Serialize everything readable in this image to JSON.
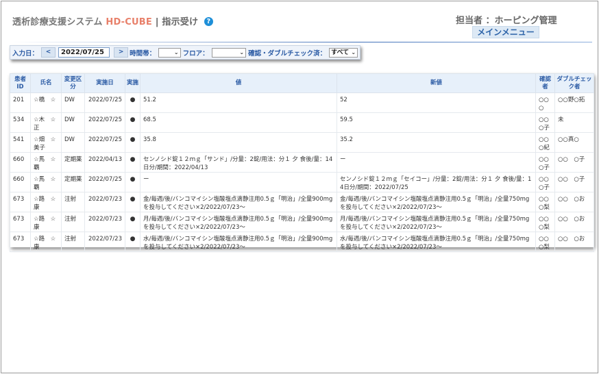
{
  "header": {
    "title_main": "透析診療支援システム",
    "title_brand": "HD-CUBE",
    "title_sep": "|",
    "title_sub": "指示受け",
    "help_icon_glyph": "?",
    "user_label": "担当者 ：ホーピング管理",
    "main_menu_label": "メインメニュー"
  },
  "filters": {
    "date_label": "入力日：",
    "prev_label": "<",
    "date_value": "2022/07/25",
    "next_label": ">",
    "time_label": "時間帯：",
    "time_value": "",
    "floor_label": "フロア：",
    "floor_value": "",
    "check_label": "確認・ダブルチェック済：",
    "check_value": "すべて"
  },
  "table": {
    "headers": {
      "patient_id": "患者ID",
      "name": "氏名",
      "change_type": "変更区分",
      "date": "実施日",
      "exec": "実施",
      "value": "値",
      "new_value": "新値",
      "confirmer": "確認者",
      "double_checker": "ダブルチェック者"
    },
    "rows": [
      {
        "id": "201",
        "name": "☆橋　☆",
        "type": "DW",
        "date": "2022/07/25",
        "exec": "●",
        "value": "51.2",
        "new_value": "52",
        "confirmer": "○○○",
        "double": "○○野○拓"
      },
      {
        "id": "534",
        "name": "☆木　☆正",
        "type": "DW",
        "date": "2022/07/25",
        "exec": "●",
        "value": "68.5",
        "new_value": "59.5",
        "confirmer": "○○○子",
        "double": "未"
      },
      {
        "id": "541",
        "name": "☆畑　☆美子",
        "type": "DW",
        "date": "2022/07/25",
        "exec": "●",
        "value": "35.8",
        "new_value": "35.2",
        "confirmer": "○○○紀",
        "double": "○○真○"
      },
      {
        "id": "660",
        "name": "☆馬　☆覇",
        "type": "定期薬",
        "date": "2022/04/13",
        "exec": "●",
        "value": "センノシド錠１２ｍｇ「サンド」/分量：2錠/用法：分１ 夕 食後/量：14日分/期間：2022/04/13",
        "new_value": "ー",
        "confirmer": "○○○子",
        "double": "○○　○子"
      },
      {
        "id": "660",
        "name": "☆馬　☆覇",
        "type": "定期薬",
        "date": "2022/07/25",
        "exec": "●",
        "value": "ー",
        "new_value": "センノシド錠１２ｍｇ「セイコー」/分量：2錠/用法：分１ 夕 食後/量：14日分/期間：2022/07/25",
        "confirmer": "○○○子",
        "double": "○○　○子"
      },
      {
        "id": "673",
        "name": "☆路　☆康",
        "type": "注射",
        "date": "2022/07/23",
        "exec": "●",
        "value": "金/毎週/後/バンコマイシン塩酸塩点滴静注用0.5ｇ「明治」/全量900mgを投与してください×2/2022/07/23〜",
        "new_value": "金/毎週/後/バンコマイシン塩酸塩点滴静注用0.5ｇ「明治」/全量750mgを投与してください×2/2022/07/23〜",
        "confirmer": "○○○梨",
        "double": "○○　○お"
      },
      {
        "id": "673",
        "name": "☆路　☆康",
        "type": "注射",
        "date": "2022/07/23",
        "exec": "●",
        "value": "月/毎週/後/バンコマイシン塩酸塩点滴静注用0.5ｇ「明治」/全量900mgを投与してください×2/2022/07/23〜",
        "new_value": "月/毎週/後/バンコマイシン塩酸塩点滴静注用0.5ｇ「明治」/全量750mgを投与してください×2/2022/07/23〜",
        "confirmer": "○○○梨",
        "double": "○○　○お"
      },
      {
        "id": "673",
        "name": "☆路　☆康",
        "type": "注射",
        "date": "2022/07/23",
        "exec": "●",
        "value": "水/毎週/後/バンコマイシン塩酸塩点滴静注用0.5ｇ「明治」/全量900mgを投与してください×2/2022/07/23〜",
        "new_value": "水/毎週/後/バンコマイシン塩酸塩点滴静注用0.5ｇ「明治」/全量750mgを投与してください×2/2022/07/23〜",
        "confirmer": "○○○梨",
        "double": "○○　○お"
      }
    ]
  },
  "colors": {
    "brand": "#e8806a",
    "accent": "#2a5aa4",
    "header_bg": "#e7f0fa",
    "help_icon": "#1e8fd8"
  }
}
